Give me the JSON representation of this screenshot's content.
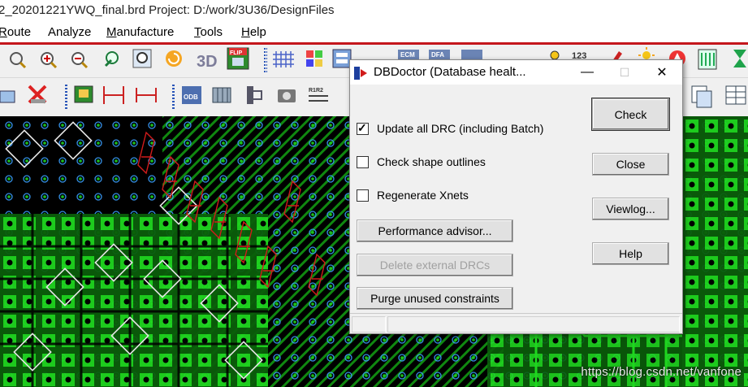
{
  "app": {
    "title": "2_20201221YWQ_final.brd  Project: D:/work/3U36/DesignFiles"
  },
  "menu": {
    "route": {
      "pre": "",
      "ul": "R",
      "post": "oute"
    },
    "analyze": {
      "pre": "Analyze",
      "ul": "",
      "post": ""
    },
    "manufacture": {
      "pre": "",
      "ul": "M",
      "post": "anufacture"
    },
    "tools": {
      "pre": "",
      "ul": "T",
      "post": "ools"
    },
    "help": {
      "pre": "",
      "ul": "H",
      "post": "elp"
    }
  },
  "toolbar_icons": {
    "row1": [
      "zoom-icon",
      "zoom-in-icon",
      "zoom-out-icon",
      "zoom-previous-icon",
      "zoom-fit-icon",
      "redraw-icon",
      "3d-view-icon",
      "flip-icon",
      "grid-icon",
      "color-icon",
      "layer-icon",
      "ecm-icon",
      "dfa-icon",
      "dfm-icon",
      "refresh-icon",
      "bulb-icon",
      "number-icon",
      "highlight-icon",
      "sun-icon",
      "shape-icon",
      "bar-icon",
      "hourglass-icon"
    ],
    "row2": [
      "select-icon",
      "delete-icon",
      "place-icon",
      "dimension-icon",
      "measure-icon",
      "odb-icon",
      "pin-icon",
      "sheet-icon",
      "camera-icon",
      "rename-icon",
      "copy-icon",
      "table-icon"
    ],
    "labels": {
      "flip": "FLIP",
      "ecm": "ECM",
      "dfa": "DFA",
      "num": "123",
      "odb": "ODB",
      "r1r2": "R1R2"
    }
  },
  "dialog": {
    "title": "DBDoctor (Database healt...",
    "window_controls": {
      "minimize": "—",
      "maximize": "☐",
      "close": "✕"
    },
    "checkboxes": [
      {
        "label": "Update all DRC (including Batch)",
        "checked": true
      },
      {
        "label": "Check shape outlines",
        "checked": false
      },
      {
        "label": "Regenerate Xnets",
        "checked": false
      }
    ],
    "buttons": {
      "performance": "Performance advisor...",
      "delete_drc": "Delete external DRCs",
      "purge": "Purge unused constraints",
      "check": "Check",
      "close": "Close",
      "viewlog": "Viewlog...",
      "help": "Help"
    },
    "check_mark": "✓"
  },
  "watermark": "https://blog.csdn.net/vanfone",
  "colors": {
    "pcb_green": "#1fd61f",
    "pcb_dark_green": "#0a6e0a",
    "pcb_red": "#d11b1b",
    "pcb_cyan": "#3aa0ff",
    "menu_separator": "#c4161c"
  }
}
